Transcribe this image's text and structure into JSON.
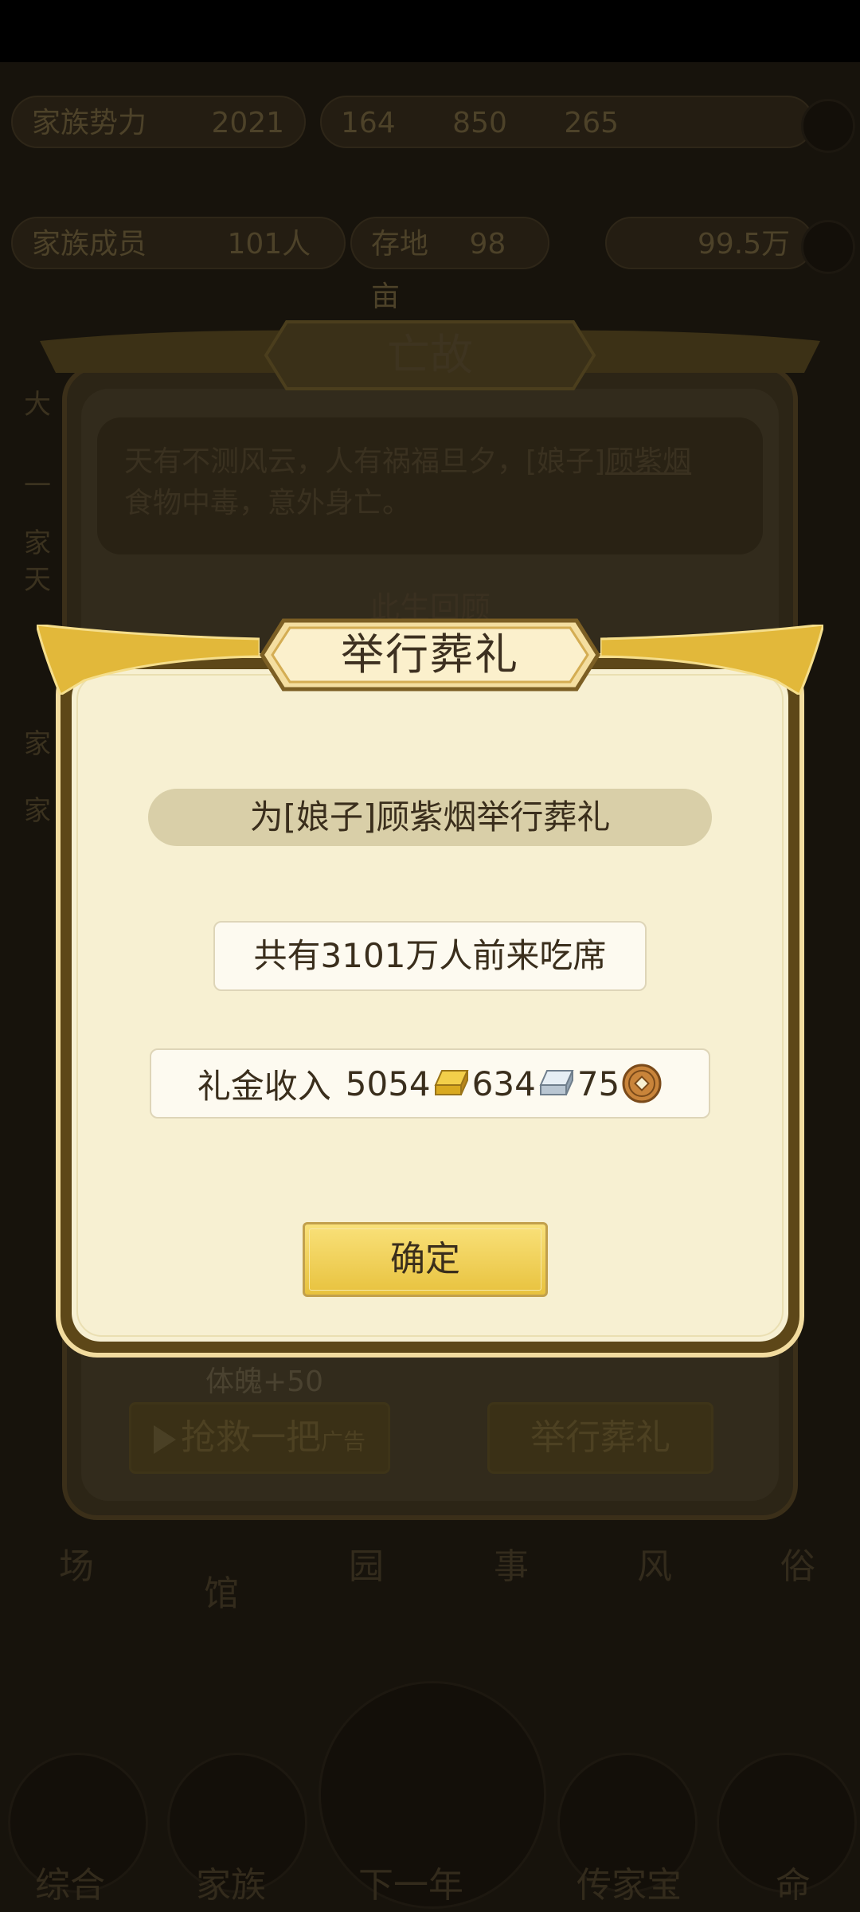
{
  "background": {
    "top_bar": {
      "family_label": "家族势力",
      "year": "2021",
      "resource_1": "164",
      "resource_2": "850",
      "resource_3": "265",
      "members_label": "家族成员",
      "members_value": "101人",
      "land_label": "存地",
      "land_value": "98亩",
      "money_value": "99.5万"
    },
    "bg_lines": [
      "大",
      "一",
      "家",
      "天",
      "家",
      "家"
    ],
    "back_dialog": {
      "title": "亡故",
      "message_before": "天有不测风云，人有祸福旦夕，[娘子]",
      "message_name": "顾紫烟",
      "message_after": "食物中毒，意外身亡。",
      "section_header": "此生回顾",
      "stat": "体魄+50",
      "rescue_button": "抢救一把",
      "rescue_ad": "广告",
      "funeral_button": "举行葬礼"
    },
    "nav_bottom": [
      "场",
      "馆",
      "园",
      "事",
      "风",
      "俗"
    ],
    "tabbar": [
      "综合",
      "家族",
      "下一年",
      "传家宝",
      "命"
    ]
  },
  "dialog": {
    "title": "举行葬礼",
    "header": "为[娘子]顾紫烟举行葬礼",
    "attendees": "共有3101万人前来吃席",
    "income_label": "礼金收入",
    "gold": "5054",
    "silver": "634",
    "copper": "75",
    "confirm_label": "确定"
  },
  "colors": {
    "dialog_bg": "#f7f0d2",
    "dialog_border": "#5d4718",
    "accent_gold": "#e8c23e",
    "pill": "#d9cfa8"
  }
}
